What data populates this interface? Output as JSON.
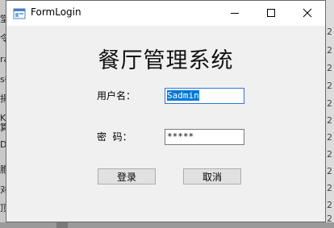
{
  "window": {
    "title": "FormLogin"
  },
  "form": {
    "heading": "餐厅管理系统",
    "username_label": "用户名：",
    "username_value": "Sadmin",
    "password_label": "密  码：",
    "password_value": "*****",
    "login_label": "登录",
    "cancel_label": "取消"
  },
  "background": {
    "left_glyphs": [
      "堂",
      "令",
      "ra",
      "sł",
      "捐",
      "K算",
      "D",
      "胞",
      "对",
      "顶"
    ],
    "right_glyphs": [
      "2",
      "2",
      "2",
      "2",
      "2",
      "2",
      "2",
      "2",
      "2",
      "2",
      "2",
      "2"
    ]
  },
  "colors": {
    "selection": "#0078d7",
    "focus_border": "#2b78d6",
    "button_face": "#e1e1e1"
  }
}
